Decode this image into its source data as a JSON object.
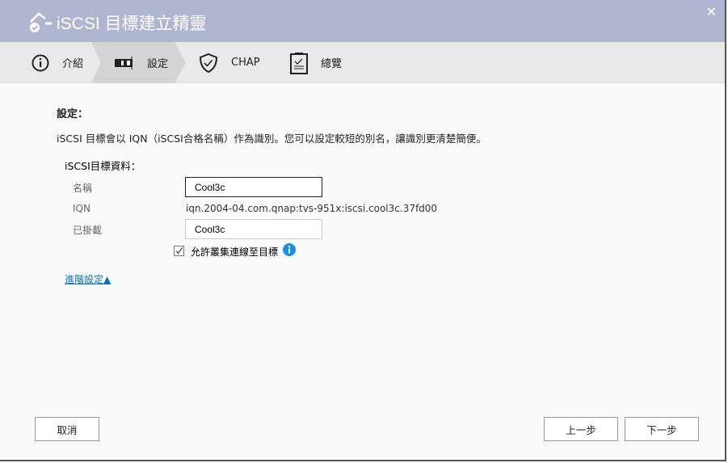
{
  "window": {
    "title": "iSCSI 目標建立精靈",
    "close": "✕"
  },
  "steps": [
    {
      "label": "介紹"
    },
    {
      "label": "設定"
    },
    {
      "label": "CHAP"
    },
    {
      "label": "總覽"
    }
  ],
  "main": {
    "heading": "設定：",
    "description": "iSCSI 目標會以 IQN（iSCSI合格名稱）作為識別。您可以設定較短的別名，讓識別更清楚簡便。",
    "section": "iSCSI目標資料：",
    "name_label": "名稱",
    "name_value": "Cool3c",
    "iqn_label": "IQN",
    "iqn_value": "iqn.2004-04.com.qnap:tvs-951x:iscsi.cool3c.37fd00",
    "alias_label": "已掛載",
    "alias_value": "Cool3c",
    "cluster_label": "允許叢集連線至目標",
    "cluster_checked": true,
    "advanced": "進階設定▲"
  },
  "footer": {
    "cancel": "取消",
    "back": "上一步",
    "next": "下一步"
  }
}
